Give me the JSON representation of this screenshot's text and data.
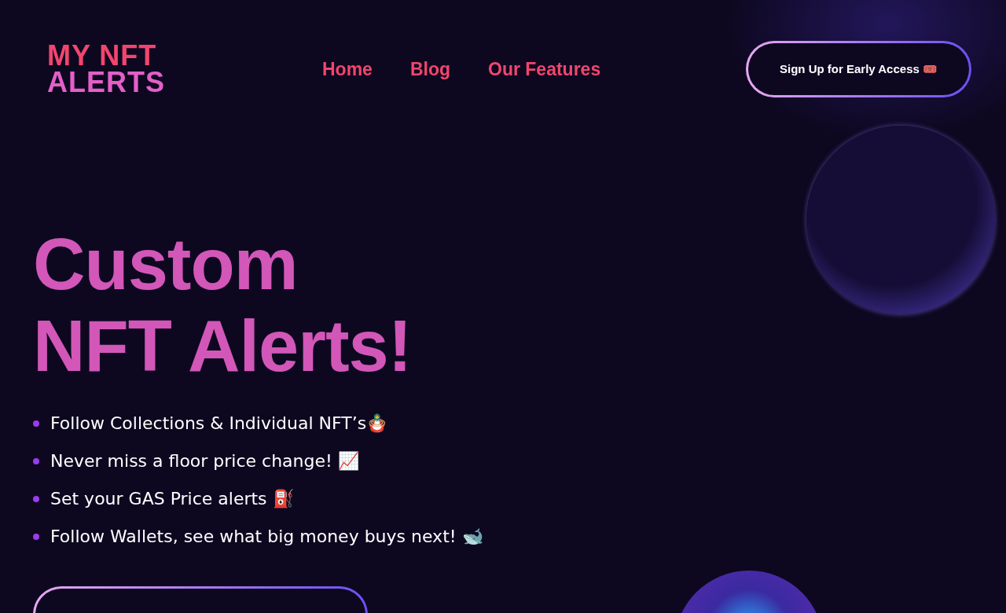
{
  "header": {
    "logo": {
      "line_1": "MY NFT",
      "line_2": "ALERTS"
    },
    "nav": [
      {
        "label": "Home"
      },
      {
        "label": "Blog"
      },
      {
        "label": "Our Features"
      }
    ],
    "cta": {
      "label": "Sign Up for Early Access 🎟️"
    }
  },
  "hero": {
    "headline": [
      "Custom",
      "NFT Alerts!"
    ],
    "features": [
      "Follow Collections & Individual NFT’s🪆",
      "Never miss a floor price change! 📈",
      "Set your GAS Price alerts ⛽",
      "Follow Wallets, see what big money buys next! 🐋"
    ]
  }
}
